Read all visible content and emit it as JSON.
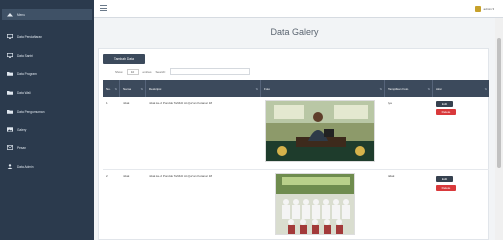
{
  "sidebar": {
    "items": [
      {
        "label": "Menu",
        "icon": "dashboard-icon",
        "active": true
      },
      {
        "label": "Data Pendaftaran",
        "icon": "monitor-icon"
      },
      {
        "label": "Data Santri",
        "icon": "monitor-icon"
      },
      {
        "label": "Data Program",
        "icon": "folder-icon"
      },
      {
        "label": "Data Wali",
        "icon": "folder-icon"
      },
      {
        "label": "Data Pengumuman",
        "icon": "folder-icon"
      },
      {
        "label": "Galery",
        "icon": "image-icon"
      },
      {
        "label": "Pesan",
        "icon": "mail-icon"
      },
      {
        "label": "Data Admin",
        "icon": "user-icon"
      }
    ]
  },
  "topbar": {
    "user_label": "admin ▾"
  },
  "page": {
    "title": "Data Galery"
  },
  "toolbar": {
    "add_label": "Tambah Data",
    "show_label": "Show",
    "show_value": "10",
    "entries_label": "entries",
    "search_label": "Search:"
  },
  "table": {
    "headers": [
      "No.",
      "Nama",
      "Deskripsi",
      "Foto",
      "Tampilkan Foto",
      "Aksi"
    ],
    "rows": [
      {
        "no": "1",
        "nama": "nikat",
        "deskripsi": "nikat ke-2 Pondok Tahfidz Al-Qur'an Kotanar 18",
        "tampilkan": "iya",
        "edit": "Edit",
        "delete": "Delete"
      },
      {
        "no": "2",
        "nama": "nikat",
        "deskripsi": "nikat ke-2 Pondok Tahfidz Al-Qur'an Kotanar 18",
        "tampilkan": "tidak",
        "edit": "Edit",
        "delete": "Delete"
      }
    ]
  },
  "colors": {
    "sidebar_bg": "#2b3a4d",
    "header_bg": "#3c4a5c",
    "delete_red": "#d9393b",
    "user_badge": "#c7a12b"
  }
}
